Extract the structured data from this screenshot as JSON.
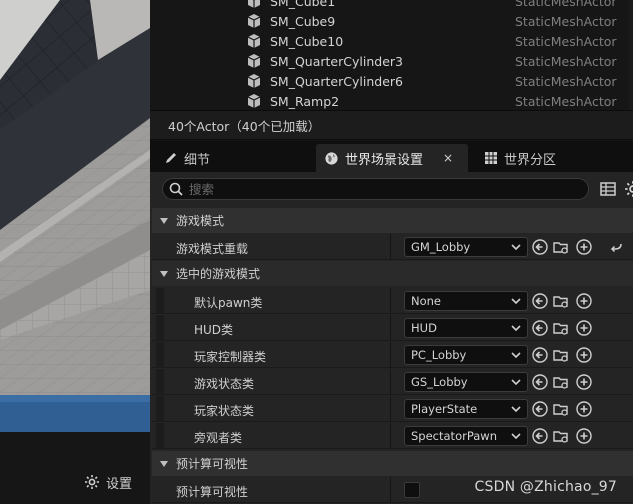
{
  "viewport": {
    "settings_label": "设置",
    "settings_icon": "gear-icon"
  },
  "outliner": {
    "rows": [
      {
        "name": "SM_Cube1",
        "type": "StaticMeshActor"
      },
      {
        "name": "SM_Cube9",
        "type": "StaticMeshActor"
      },
      {
        "name": "SM_Cube10",
        "type": "StaticMeshActor"
      },
      {
        "name": "SM_QuarterCylinder3",
        "type": "StaticMeshActor"
      },
      {
        "name": "SM_QuarterCylinder6",
        "type": "StaticMeshActor"
      },
      {
        "name": "SM_Ramp2",
        "type": "StaticMeshActor"
      }
    ],
    "row_icon": "static-mesh-cube-icon",
    "actor_count": "40个Actor（40个已加载）"
  },
  "tabs": [
    {
      "label": "细节",
      "icon": "details-pencil-icon",
      "active": false
    },
    {
      "label": "世界场景设置",
      "icon": "world-globe-icon",
      "active": true,
      "close": "×"
    },
    {
      "label": "世界分区",
      "icon": "world-partition-icon",
      "active": false
    }
  ],
  "details": {
    "search_placeholder": "搜索",
    "categories": {
      "game_mode": "游戏模式",
      "selected_game_mode": "选中的游戏模式",
      "precomputed_visibility": "预计算可视性"
    },
    "override": {
      "label": "游戏模式重载",
      "value": "GM_Lobby"
    },
    "selected_rows": [
      {
        "label": "默认pawn类",
        "value": "None"
      },
      {
        "label": "HUD类",
        "value": "HUD"
      },
      {
        "label": "玩家控制器类",
        "value": "PC_Lobby"
      },
      {
        "label": "游戏状态类",
        "value": "GS_Lobby"
      },
      {
        "label": "玩家状态类",
        "value": "PlayerState"
      },
      {
        "label": "旁观者类",
        "value": "SpectatorPawn"
      }
    ],
    "precomputed_row": {
      "label": "预计算可视性",
      "checked": false
    }
  },
  "watermark": "CSDN @Zhichao_97",
  "colors": {
    "panel_bg": "#242424",
    "category_bg": "#303030",
    "viewport_sky": "#2f5f93",
    "floor_tile": "#9b9a98"
  }
}
